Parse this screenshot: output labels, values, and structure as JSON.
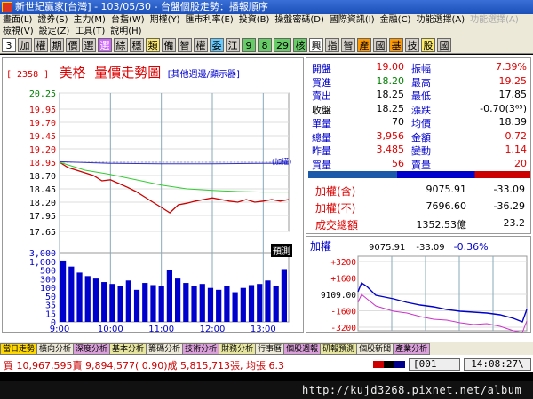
{
  "window": {
    "title": "新世紀贏家[台灣] - 103/05/30 - 台盤個股走勢：播報順序"
  },
  "menu": {
    "row1": [
      {
        "label": "畫面(L)",
        "enabled": true
      },
      {
        "label": "證券(S)",
        "enabled": true
      },
      {
        "label": "主力(M)",
        "enabled": true
      },
      {
        "label": "台指(W)",
        "enabled": true
      },
      {
        "label": "期權(Y)",
        "enabled": true
      },
      {
        "label": "匯市利率(E)",
        "enabled": true
      },
      {
        "label": "投資(B)",
        "enabled": true
      },
      {
        "label": "操盤密碼(D)",
        "enabled": true
      },
      {
        "label": "國際資訊(I)",
        "enabled": true
      },
      {
        "label": "金融(C)",
        "enabled": true
      },
      {
        "label": "功能選擇(A)",
        "enabled": true
      },
      {
        "label": "功能選擇(A)",
        "enabled": false
      }
    ],
    "row2": [
      "檢視(V)",
      "設定(Z)",
      "工具(T)",
      "說明(H)"
    ]
  },
  "toolbar": {
    "buttons": [
      {
        "label": "3",
        "style": "w"
      },
      {
        "label": "加",
        "style": ""
      },
      {
        "label": "權",
        "style": ""
      },
      {
        "label": "期",
        "style": ""
      },
      {
        "label": "價",
        "style": ""
      },
      {
        "label": "選",
        "style": ""
      },
      {
        "label": "選",
        "style": "p"
      },
      {
        "label": "綜",
        "style": ""
      },
      {
        "label": "穩",
        "style": ""
      },
      {
        "label": "類",
        "style": "y"
      },
      {
        "label": "備",
        "style": ""
      },
      {
        "label": "智",
        "style": ""
      },
      {
        "label": "權",
        "style": ""
      },
      {
        "label": "委",
        "style": "c"
      },
      {
        "label": "江",
        "style": ""
      },
      {
        "label": "9",
        "style": "g"
      },
      {
        "label": "8",
        "style": "g"
      },
      {
        "label": "29",
        "style": "g"
      },
      {
        "label": "核",
        "style": "g"
      },
      {
        "label": "興",
        "style": "w"
      },
      {
        "label": "指",
        "style": ""
      },
      {
        "label": "智",
        "style": ""
      },
      {
        "label": "產",
        "style": "o"
      },
      {
        "label": "國",
        "style": ""
      },
      {
        "label": "基",
        "style": "o"
      },
      {
        "label": "技",
        "style": ""
      },
      {
        "label": "股",
        "style": "y"
      },
      {
        "label": "國",
        "style": ""
      }
    ]
  },
  "chart_header": {
    "code": "[ 2358 ]",
    "name": "美格",
    "title": "量價走勢圖",
    "sub": "[其他週邊/顯示器]",
    "limit_note": "(加權)",
    "forecast_btn": "預測"
  },
  "chart_data": {
    "type": "line",
    "title": "量價走勢圖",
    "price_ticks": [
      "20.25",
      "19.95",
      "19.70",
      "19.45",
      "19.20",
      "18.95",
      "18.70",
      "18.45",
      "18.20",
      "17.95",
      "17.65"
    ],
    "price_range": [
      17.65,
      20.25
    ],
    "volume_ticks": [
      "3,000",
      "1,000",
      "500",
      "300",
      "100",
      "50",
      "35",
      "15",
      "0"
    ],
    "x_ticks": [
      "9:00",
      "10:00",
      "11:00",
      "12:00",
      "13:00"
    ],
    "reference_price": 18.95,
    "series": [
      {
        "name": "price",
        "color": "#cc0000",
        "x": [
          "9:00",
          "9:10",
          "9:20",
          "9:30",
          "9:40",
          "9:50",
          "10:00",
          "10:10",
          "10:20",
          "10:30",
          "10:40",
          "10:50",
          "11:00",
          "11:10",
          "11:20",
          "11:30",
          "11:40",
          "11:50",
          "12:00",
          "12:10",
          "12:20",
          "12:30",
          "12:40",
          "12:50",
          "13:00",
          "13:10",
          "13:20",
          "13:30"
        ],
        "values": [
          18.95,
          18.85,
          18.8,
          18.75,
          18.7,
          18.6,
          18.62,
          18.55,
          18.48,
          18.4,
          18.3,
          18.2,
          18.1,
          18.0,
          18.15,
          18.18,
          18.22,
          18.25,
          18.28,
          18.25,
          18.22,
          18.2,
          18.25,
          18.2,
          18.22,
          18.25,
          18.22,
          18.25
        ]
      },
      {
        "name": "average",
        "color": "#33cc33",
        "x": [
          "9:00",
          "9:30",
          "10:00",
          "10:30",
          "11:00",
          "11:30",
          "12:00",
          "12:30",
          "13:00",
          "13:30"
        ],
        "values": [
          18.95,
          18.8,
          18.72,
          18.62,
          18.52,
          18.45,
          18.42,
          18.4,
          18.39,
          18.39
        ]
      },
      {
        "name": "index",
        "color": "#3333cc",
        "x": [
          "9:00",
          "10:00",
          "11:00",
          "12:00",
          "13:00",
          "13:30"
        ],
        "values": [
          18.96,
          18.93,
          18.92,
          18.92,
          18.93,
          18.93
        ]
      }
    ],
    "volume": [
      1200,
      600,
      300,
      200,
      150,
      100,
      80,
      60,
      120,
      40,
      90,
      70,
      60,
      400,
      150,
      90,
      60,
      80,
      50,
      40,
      60,
      30,
      50,
      70,
      80,
      120,
      60,
      450
    ],
    "legend": "none"
  },
  "quote": {
    "rows": [
      {
        "l1": "開盤",
        "v1": "19.00",
        "v1c": "qred",
        "l2": "振幅",
        "v2": "7.39%",
        "v2c": "qred"
      },
      {
        "l1": "買進",
        "v1": "18.20",
        "v1c": "qgreen",
        "l2": "最高",
        "v2": "19.25",
        "v2c": "qred"
      },
      {
        "l1": "賣出",
        "v1": "18.25",
        "v1c": "qblack",
        "l2": "最低",
        "v2": "17.85",
        "v2c": "qblack"
      },
      {
        "l1": "收盤",
        "v1": "18.25",
        "v1c": "qblack",
        "l2": "漲跌",
        "v2": "-0.70(3⁶⁵)",
        "v2c": "qblack"
      },
      {
        "l1": "單量",
        "v1": "70",
        "v1c": "qblack",
        "l2": "均價",
        "v2": "18.39",
        "v2c": "qblack"
      },
      {
        "l1": "總量",
        "v1": "3,956",
        "v1c": "qred",
        "l2": "金額",
        "v2": "0.72",
        "v2c": "qred"
      },
      {
        "l1": "昨量",
        "v1": "3,485",
        "v1c": "qred",
        "l2": "變動",
        "v2": "1.14",
        "v2c": "qred"
      },
      {
        "l1": "買量",
        "v1": "56",
        "v1c": "qred",
        "l2": "賣量",
        "v2": "20",
        "v2c": "qred"
      }
    ],
    "index_rows": [
      {
        "label": "加權(含)",
        "value": "9075.91",
        "change": "-33.09"
      },
      {
        "label": "加權(不)",
        "value": "7696.60",
        "change": "-36.29"
      },
      {
        "label": "成交總額",
        "value": "1352.53億",
        "change": "23.2"
      }
    ]
  },
  "index_chart": {
    "label": "加權",
    "value": "9075.91",
    "change": "-33.09",
    "pct": "-0.36%",
    "ticks": [
      "+3200",
      "+1600",
      "9109.00",
      "-1600",
      "-3200"
    ]
  },
  "tabs": [
    {
      "label": "當日走勢",
      "active": true
    },
    {
      "label": "橫向分析",
      "active": false
    },
    {
      "label": "深度分析",
      "active": false
    },
    {
      "label": "基本分析",
      "active": false
    },
    {
      "label": "籌碼分析",
      "active": false
    },
    {
      "label": "技術分析",
      "active": false
    },
    {
      "label": "財務分析",
      "active": false
    },
    {
      "label": "行事曆",
      "active": false
    },
    {
      "label": "個股週報",
      "active": false
    },
    {
      "label": "研報預測",
      "active": false
    },
    {
      "label": "個股新聞",
      "active": false
    },
    {
      "label": "產業分析",
      "active": false
    }
  ],
  "ticker": {
    "text": "買 10,967,595賣 9,894,577( 0.90)成 5,815,713張, 均張 6.3",
    "code": "[001",
    "clock": "14:08:27\\"
  },
  "address": {
    "url": "http://kujd3268.pixnet.net/album"
  },
  "colors": {
    "accent": "#d00",
    "buy": "#008000",
    "label": "#0000cc"
  }
}
